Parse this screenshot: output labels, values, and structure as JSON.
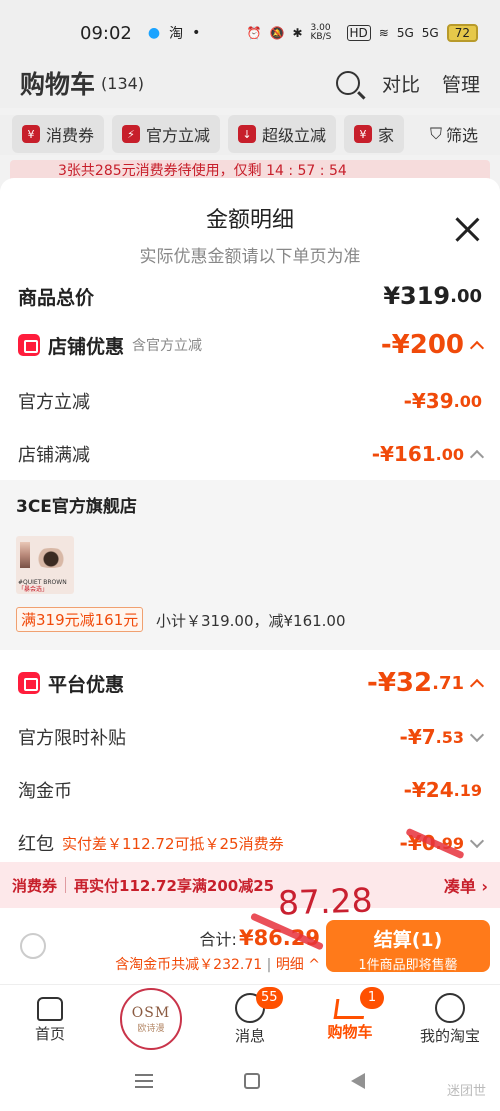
{
  "status_bar": {
    "time": "09:02",
    "icons": [
      "app-drop-icon",
      "taobao-icon",
      "dot-icon",
      "alarm-icon",
      "mute-icon",
      "bluetooth-icon"
    ],
    "net_speed": "3.00 KB/S",
    "hd": "HD",
    "signal1": "5G",
    "signal2": "5G",
    "battery": "72"
  },
  "header": {
    "title": "购物车",
    "count": "(134)",
    "compare": "对比",
    "manage": "管理"
  },
  "chips": [
    {
      "label": "消费券"
    },
    {
      "label": "官方立减"
    },
    {
      "label": "超级立减"
    },
    {
      "label": "家"
    },
    {
      "label": "筛选"
    }
  ],
  "coupon_strip": "3张共285元消费券待使用，仅剩 14 : 57 : 54",
  "sheet": {
    "title": "金额明细",
    "subtitle": "实际优惠金额请以下单页为准",
    "total_label": "商品总价",
    "total_value": "¥319",
    "total_decimal": ".00",
    "store_label": "店铺优惠",
    "store_note": "含官方立减",
    "store_value": "-¥200",
    "official_cut_label": "官方立减",
    "official_cut_value": "-¥39",
    "official_cut_decimal": ".00",
    "store_full_label": "店铺满减",
    "store_full_value": "-¥161",
    "store_full_decimal": ".00",
    "store_name": "3CE官方旗舰店",
    "thumb_text": "#QUIET BROWN",
    "thumb_text2": "「暴会选」",
    "promo_tag": "满319元减161元",
    "subtotal": "小计￥319.00，减¥161.00",
    "platform_label": "平台优惠",
    "platform_value": "-¥32",
    "platform_decimal": ".71",
    "subsidy_label": "官方限时补贴",
    "subsidy_value": "-¥7",
    "subsidy_decimal": ".53",
    "coin_label": "淘金币",
    "coin_value": "-¥24",
    "coin_decimal": ".19",
    "redpacket_label": "红包",
    "redpacket_note": "实付差￥112.72可抵￥25消费券",
    "redpacket_value": "-¥0",
    "redpacket_decimal": ".99"
  },
  "coupon_bar": {
    "label": "消费券",
    "text": "再实付112.72享满200减25",
    "link": "凑单"
  },
  "checkout": {
    "sum_label": "合计:",
    "sum_amount": "¥86.29",
    "sub_text": "含淘金币共减￥232.71",
    "detail": "明细",
    "button_main": "结算(1)",
    "button_sub": "1件商品即将售罄",
    "handwritten": "87.28"
  },
  "tabs": [
    {
      "label": "首页"
    },
    {
      "label": "",
      "logo_text": "OSM",
      "logo_sub": "欧诗漫"
    },
    {
      "label": "消息",
      "badge": "55"
    },
    {
      "label": "购物车",
      "badge": "1"
    },
    {
      "label": "我的淘宝"
    }
  ],
  "watermark": "迷团世"
}
